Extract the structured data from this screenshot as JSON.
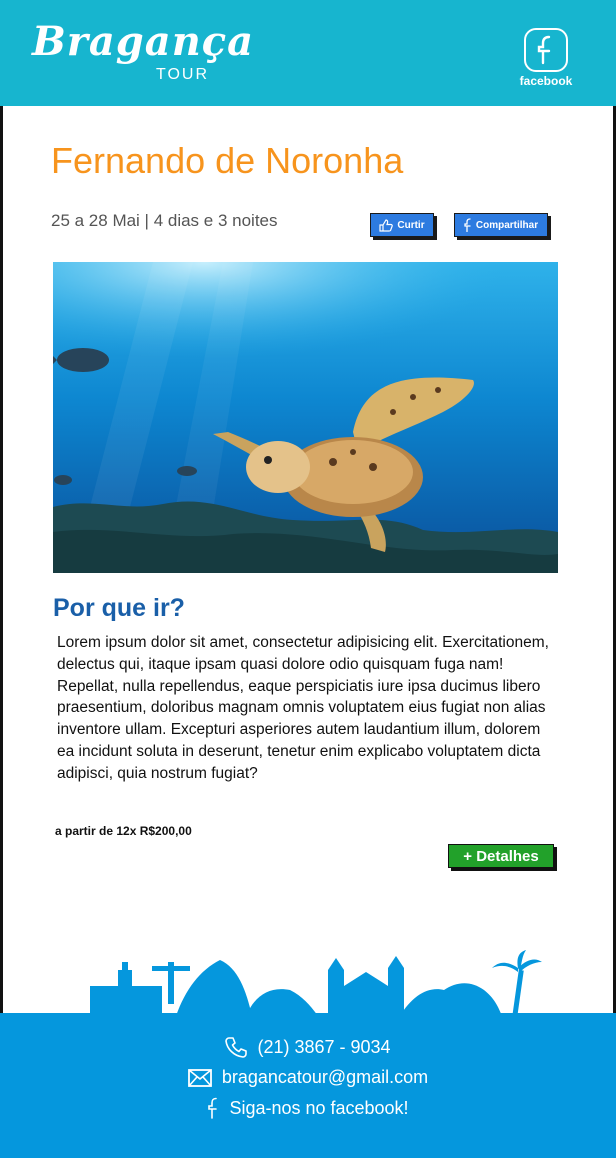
{
  "header": {
    "brand_name": "Bragança",
    "brand_sub": "TOUR",
    "facebook_label": "facebook"
  },
  "trip": {
    "title": "Fernando de Noronha",
    "dates": "25 a 28 Mai | 4 dias e 3 noites",
    "like_label": "Curtir",
    "share_label": "Compartilhar"
  },
  "why": {
    "heading": "Por que ir?",
    "body": "Lorem ipsum dolor sit amet, consectetur adipisicing elit. Exercitationem, delectus qui, itaque ipsam quasi dolore odio quisquam fuga nam! Repellat, nulla repellendus, eaque perspiciatis iure ipsa ducimus libero praesentium, doloribus magnam omnis voluptatem eius fugiat non alias inventore ullam. Excepturi asperiores autem laudantium illum, dolorem ea incidunt soluta in deserunt, tenetur enim explicabo voluptatem dicta adipisci, quia nostrum fugiat?"
  },
  "offer": {
    "price": "a partir de 12x R$200,00",
    "details_label": "+ Detalhes"
  },
  "footer": {
    "phone": "(21) 3867 - 9034",
    "email": "bragancatour@gmail.com",
    "facebook_cta": "Siga-nos no facebook!"
  },
  "colors": {
    "header_bg": "#17b5cf",
    "title": "#f7941d",
    "heading": "#1a5fa8",
    "social_button": "#2d7be0",
    "details_button": "#22a12a",
    "footer_bg": "#0597dd"
  }
}
